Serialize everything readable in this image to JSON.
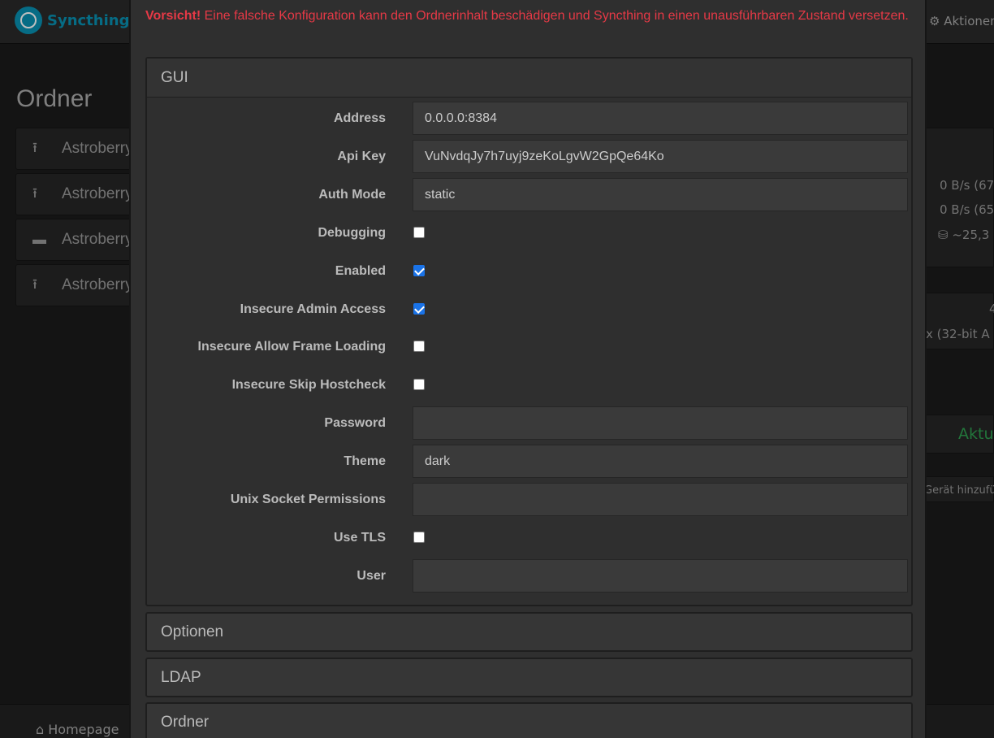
{
  "app": {
    "brand": "Syncthing",
    "actions_label": "Aktionen"
  },
  "background": {
    "folders_title": "Ordner",
    "folders": [
      {
        "name": "Astroberry",
        "icon": "upload-icon"
      },
      {
        "name": "Astroberry",
        "icon": "upload-icon"
      },
      {
        "name": "Astroberry",
        "icon": "folder-icon"
      },
      {
        "name": "Astroberry",
        "icon": "upload-icon"
      }
    ],
    "right_panel": {
      "download_rate": "0 B/s (67",
      "upload_rate": "0 B/s (65",
      "local_state": "~25,3",
      "device_count": "4",
      "version": "x (32-bit A",
      "update_label": "Aktu",
      "add_device_label": "Gerät hinzufü"
    },
    "footer_link": "Homepage"
  },
  "modal": {
    "warning_strong": "Vorsicht!",
    "warning_text": " Eine falsche Konfiguration kann den Ordnerinhalt beschädigen und Syncthing in einen unausführbaren Zustand versetzen.",
    "gui_section_title": "GUI",
    "fields": {
      "address": {
        "label": "Address",
        "value": "0.0.0.0:8384"
      },
      "api_key": {
        "label": "Api Key",
        "value": "VuNvdqJy7h7uyj9zeKoLgvW2GpQe64Ko"
      },
      "auth_mode": {
        "label": "Auth Mode",
        "value": "static"
      },
      "debugging": {
        "label": "Debugging",
        "checked": false
      },
      "enabled": {
        "label": "Enabled",
        "checked": true
      },
      "insecure_admin_access": {
        "label": "Insecure Admin Access",
        "checked": true
      },
      "insecure_allow_frame_loading": {
        "label": "Insecure Allow Frame Loading",
        "checked": false
      },
      "insecure_skip_hostcheck": {
        "label": "Insecure Skip Hostcheck",
        "checked": false
      },
      "password": {
        "label": "Password",
        "value": ""
      },
      "theme": {
        "label": "Theme",
        "value": "dark"
      },
      "unix_socket_permissions": {
        "label": "Unix Socket Permissions",
        "value": ""
      },
      "use_tls": {
        "label": "Use TLS",
        "checked": false
      },
      "user": {
        "label": "User",
        "value": ""
      }
    },
    "sections": [
      "Optionen",
      "LDAP",
      "Ordner"
    ]
  },
  "colors": {
    "brand": "#0891b2",
    "warning": "#e63946",
    "checkbox_checked": "#1a73e8",
    "update_green": "#2e9e4f"
  }
}
